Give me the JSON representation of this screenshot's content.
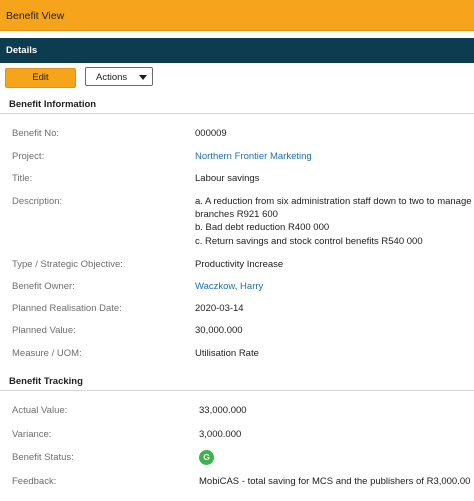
{
  "header": {
    "title": "Benefit View"
  },
  "details": {
    "title": "Details"
  },
  "toolbar": {
    "edit_label": "Edit",
    "actions_label": "Actions"
  },
  "benefit_information": {
    "section_title": "Benefit Information",
    "benefit_no": {
      "label": "Benefit No:",
      "value": "000009"
    },
    "project": {
      "label": "Project:",
      "value": "Northern Frontier Marketing"
    },
    "title": {
      "label": "Title:",
      "value": "Labour savings"
    },
    "description": {
      "label": "Description:",
      "lines": [
        "a. A reduction from six administration staff down to two to manage",
        "branches R921 600",
        "b. Bad debt reduction R400 000",
        "c. Return savings and stock control benefits R540 000"
      ]
    },
    "objective": {
      "label": "Type / Strategic Objective:",
      "value": "Productivity Increase"
    },
    "owner": {
      "label": "Benefit Owner:",
      "value": "Waczkow, Harry"
    },
    "realisation_date": {
      "label": "Planned Realisation Date:",
      "value": "2020-03-14"
    },
    "planned_value": {
      "label": "Planned Value:",
      "value": "30,000.000"
    },
    "measure": {
      "label": "Measure / UOM:",
      "value": "Utilisation Rate"
    }
  },
  "benefit_tracking": {
    "section_title": "Benefit Tracking",
    "actual_value": {
      "label": "Actual Value:",
      "value": "33,000.000"
    },
    "variance": {
      "label": "Variance:",
      "value": "3,000.000"
    },
    "status": {
      "label": "Benefit Status:",
      "badge": "G",
      "color": "#3db34a"
    },
    "feedback": {
      "label": "Feedback:",
      "value": "MobiCAS - total saving for MCS and the publishers of R3,000.00"
    }
  }
}
